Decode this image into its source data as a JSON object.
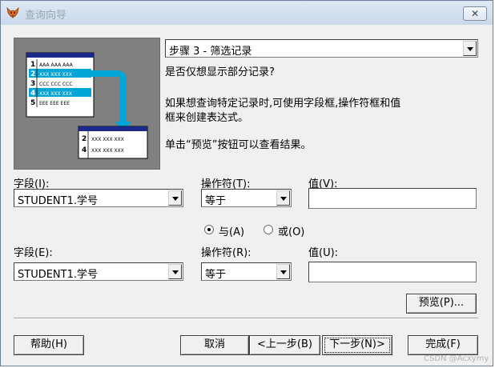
{
  "window": {
    "title": "查询向导",
    "close_symbol": "✕"
  },
  "step_select": {
    "value": "步骤 3 - 筛选记录"
  },
  "prompt": "是否仅想显示部分记录?",
  "description_line1": "如果想查询特定记录时,可使用字段框,操作符框和值",
  "description_line2": "框来创建表达式。",
  "preview_hint": "单击“预览”按钮可以查看结果。",
  "illustration": {
    "rows_top": [
      {
        "num": "1",
        "text": "AAA AAA AAA"
      },
      {
        "num": "2",
        "text": "XXX XXX XXX"
      },
      {
        "num": "3",
        "text": "CCC CCC CCC"
      },
      {
        "num": "4",
        "text": "XXX XXX XXX"
      },
      {
        "num": "5",
        "text": "EEE EEE EEE"
      }
    ],
    "rows_bottom": [
      {
        "num": "2",
        "text": "XXX XXX XXX"
      },
      {
        "num": "4",
        "text": "XXX XXX XXX"
      }
    ]
  },
  "condition1": {
    "field_label": "字段(I):",
    "field_value": "STUDENT1.学号",
    "operator_label": "操作符(T):",
    "operator_value": "等于",
    "value_label": "值(V):",
    "value_text": ""
  },
  "logic": {
    "and_label": "与(A)",
    "or_label": "或(O)",
    "selected": "and"
  },
  "condition2": {
    "field_label": "字段(E):",
    "field_value": "STUDENT1.学号",
    "operator_label": "操作符(R):",
    "operator_value": "等于",
    "value_label": "值(U):",
    "value_text": ""
  },
  "buttons": {
    "preview": "预览(P)...",
    "help": "帮助(H)",
    "cancel": "取消",
    "back": "<上一步(B)",
    "next": "下一步(N)>",
    "finish": "完成(F)"
  },
  "watermark": "CSDN @Acxymy"
}
